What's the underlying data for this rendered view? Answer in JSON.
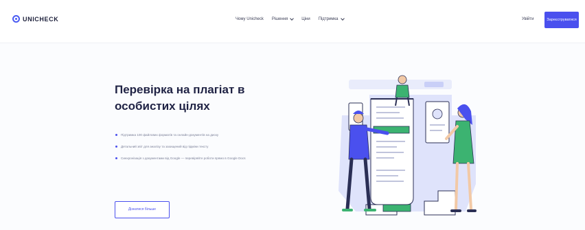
{
  "header": {
    "logo_text": "UNICHECK",
    "nav": [
      {
        "label": "Чому Unicheck",
        "has_dropdown": false
      },
      {
        "label": "Рішення",
        "has_dropdown": true
      },
      {
        "label": "Ціни",
        "has_dropdown": false
      },
      {
        "label": "Підтримка",
        "has_dropdown": true
      }
    ],
    "login_label": "Увійти",
    "cta_label": "Зареєструватися"
  },
  "hero": {
    "title": "Перевірка на плагіат в особистих цілях",
    "bullets": [
      "Підтримка 100 файлових форматів та онлайн-документів на диску",
      "Детальний звіт для аналізу та захищений від підміни тексту",
      "Синхронізація з документами від Google — перевіряйте роботи прямо в Google Docs"
    ],
    "secondary_button": "Дізнатися більше"
  },
  "colors": {
    "accent": "#4a50ee",
    "illustration_green": "#3cb371",
    "illustration_blue_bg": "#dfe3fb"
  }
}
